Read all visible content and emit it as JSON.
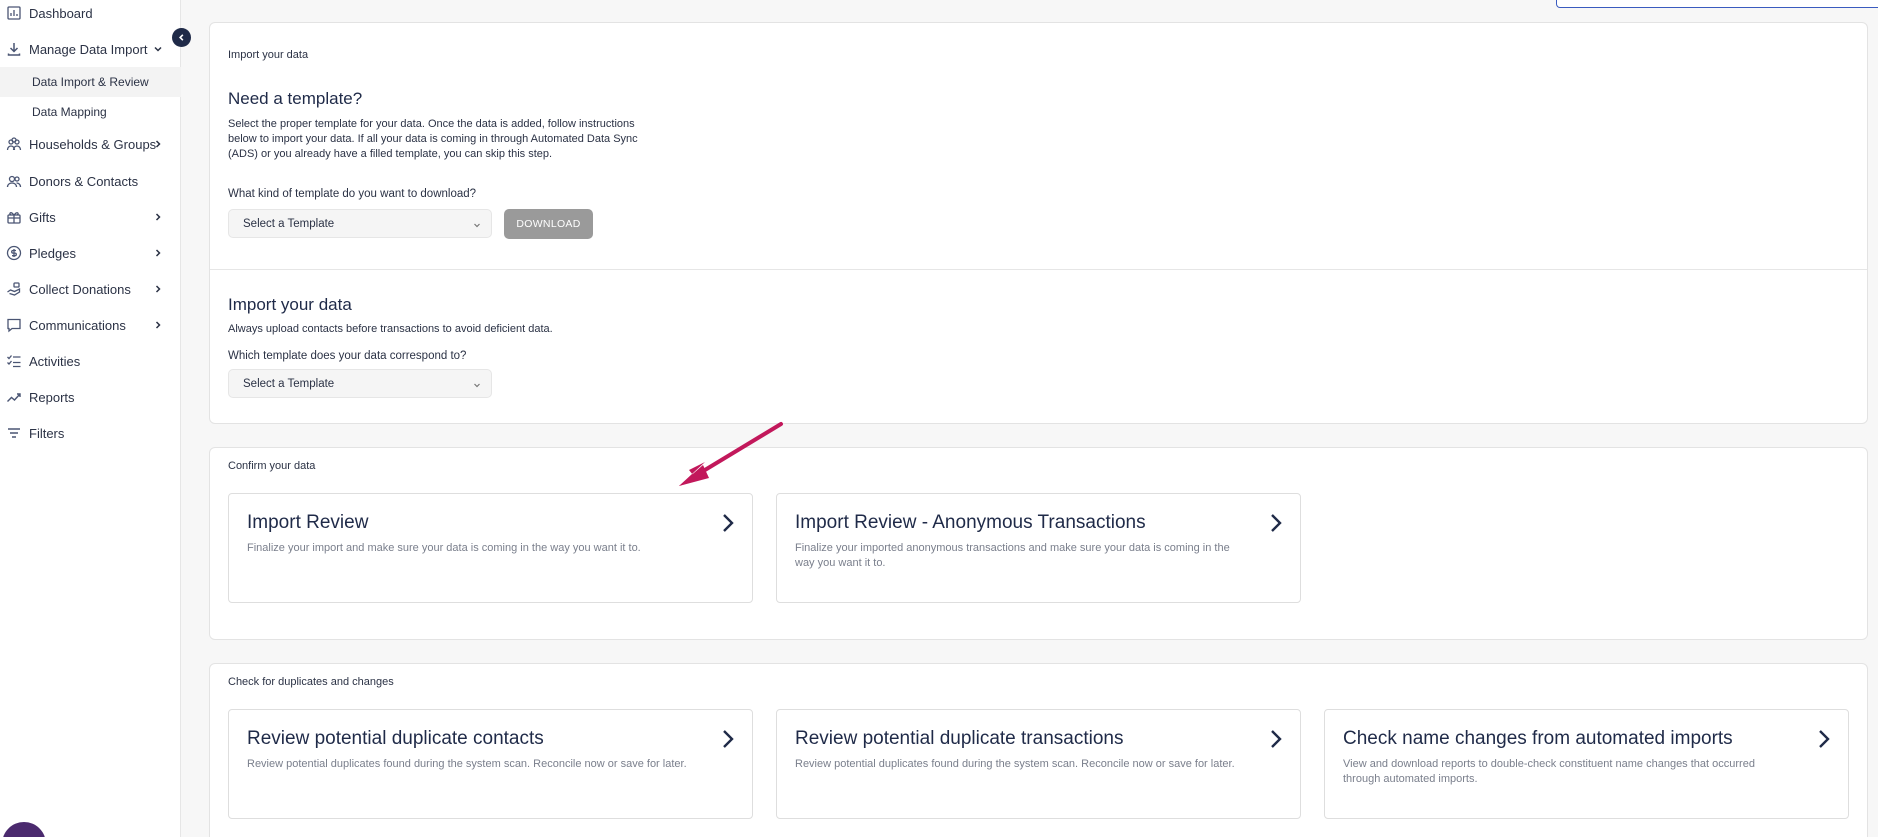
{
  "sidebar": {
    "items": [
      {
        "label": "Dashboard",
        "icon": "dashboard-icon"
      },
      {
        "label": "Manage Data Import",
        "icon": "download-icon",
        "expanded": true
      },
      {
        "label": "Households & Groups",
        "icon": "households-icon"
      },
      {
        "label": "Donors & Contacts",
        "icon": "contacts-icon"
      },
      {
        "label": "Gifts",
        "icon": "gift-icon"
      },
      {
        "label": "Pledges",
        "icon": "pledge-icon"
      },
      {
        "label": "Collect Donations",
        "icon": "collect-icon"
      },
      {
        "label": "Communications",
        "icon": "chat-icon"
      },
      {
        "label": "Activities",
        "icon": "checklist-icon"
      },
      {
        "label": "Reports",
        "icon": "chart-line-icon"
      },
      {
        "label": "Filters",
        "icon": "filter-icon"
      }
    ],
    "subitems": [
      {
        "label": "Data Import & Review",
        "active": true
      },
      {
        "label": "Data Mapping",
        "active": false
      }
    ]
  },
  "import_panel": {
    "section_label": "Import your data",
    "template_heading": "Need a template?",
    "template_desc": "Select the proper template for your data. Once the data is added, follow instructions below to import your data. If all your data is coming in through Automated Data Sync (ADS) or you already have a filled template, you can skip this step.",
    "template_question": "What kind of template do you want to download?",
    "template_select": "Select a Template",
    "download_label": "DOWNLOAD",
    "import_heading": "Import your data",
    "import_desc": "Always upload contacts before transactions to avoid deficient data.",
    "import_question": "Which template does your data correspond to?",
    "import_select": "Select a Template"
  },
  "confirm_panel": {
    "section_label": "Confirm your data",
    "cards": [
      {
        "title": "Import Review",
        "desc": "Finalize your import and make sure your data is coming in the way you want it to."
      },
      {
        "title": "Import Review - Anonymous Transactions",
        "desc": "Finalize your imported anonymous transactions and make sure your data is coming in the way you want it to."
      }
    ]
  },
  "duplicates_panel": {
    "section_label": "Check for duplicates and changes",
    "cards": [
      {
        "title": "Review potential duplicate contacts",
        "desc": "Review potential duplicates found during the system scan. Reconcile now or save for later."
      },
      {
        "title": "Review potential duplicate transactions",
        "desc": "Review potential duplicates found during the system scan. Reconcile now or save for later."
      },
      {
        "title": "Check name changes from automated imports",
        "desc": "View and download reports to double-check constituent name changes that occurred through automated imports."
      }
    ]
  },
  "colors": {
    "accent_navy": "#1f2a48",
    "annotation_arrow": "#c2185b",
    "download_disabled": "#9a9a9a"
  }
}
